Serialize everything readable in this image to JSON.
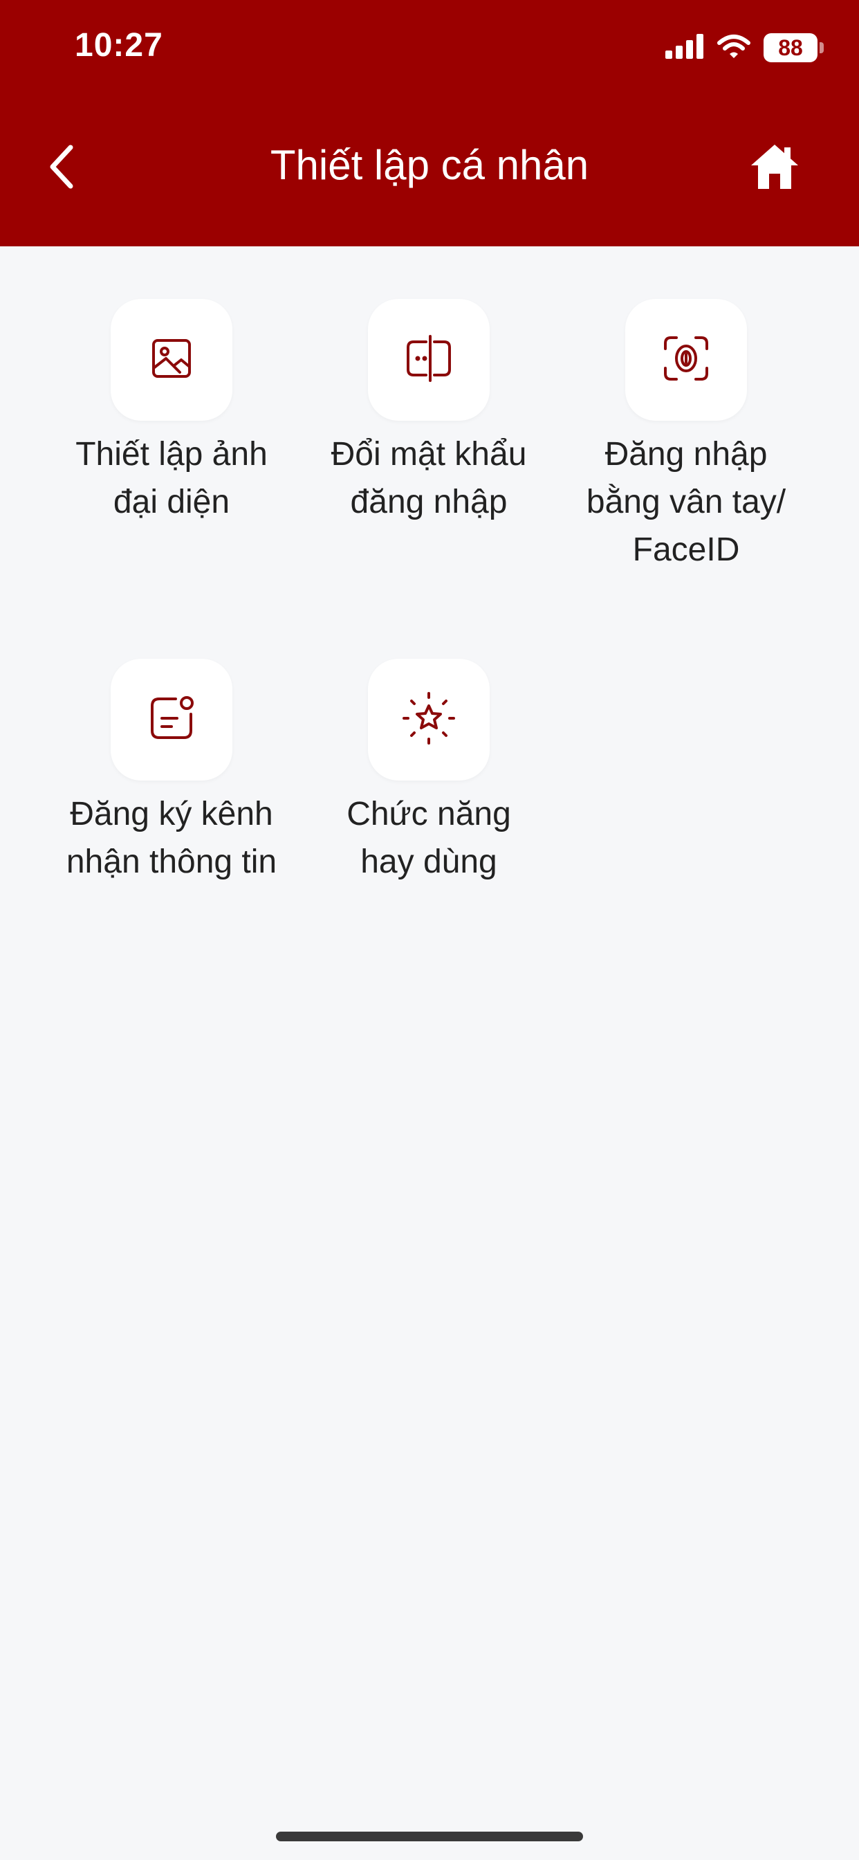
{
  "status_bar": {
    "time": "10:27",
    "battery": "88",
    "icons": [
      "signal-icon",
      "wifi-icon",
      "battery-icon"
    ]
  },
  "header": {
    "title": "Thiết lập cá nhân",
    "back_icon": "chevron-left-icon",
    "home_icon": "home-icon",
    "background_color": "#9b0000"
  },
  "menu": {
    "accent_color": "#8b0a0a",
    "items": [
      {
        "icon": "image-icon",
        "label": "Thiết lập ảnh\nđại diện"
      },
      {
        "icon": "password-icon",
        "label": "Đổi mật khẩu\nđăng nhập"
      },
      {
        "icon": "fingerprint-faceid-icon",
        "label": "Đăng nhập\nbằng vân tay/\nFaceID"
      },
      {
        "icon": "notification-channel-icon",
        "label": "Đăng ký kênh\nnhận thông tin"
      },
      {
        "icon": "favorite-function-icon",
        "label": "Chức năng\nhay dùng"
      }
    ]
  }
}
